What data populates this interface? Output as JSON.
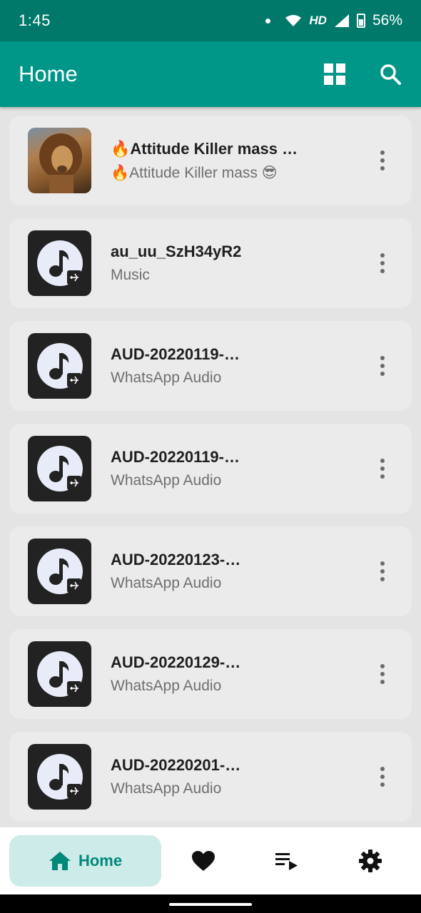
{
  "status_bar": {
    "time": "1:45",
    "network": "HD",
    "battery": "56%"
  },
  "app_bar": {
    "title": "Home",
    "actions": [
      "grid-view-icon",
      "search-icon"
    ]
  },
  "songs": [
    {
      "title": "🔥Attitude Killer mass …",
      "subtitle": "🔥Attitude Killer mass 😎",
      "thumb": "lion-photo"
    },
    {
      "title": "au_uu_SzH34yR2",
      "subtitle": "Music",
      "thumb": "music-note-icon"
    },
    {
      "title": "AUD-20220119-…",
      "subtitle": "WhatsApp Audio",
      "thumb": "music-note-icon"
    },
    {
      "title": "AUD-20220119-…",
      "subtitle": "WhatsApp Audio",
      "thumb": "music-note-icon"
    },
    {
      "title": "AUD-20220123-…",
      "subtitle": "WhatsApp Audio",
      "thumb": "music-note-icon"
    },
    {
      "title": "AUD-20220129-…",
      "subtitle": "WhatsApp Audio",
      "thumb": "music-note-icon"
    },
    {
      "title": "AUD-20220201-…",
      "subtitle": "WhatsApp Audio",
      "thumb": "music-note-icon"
    }
  ],
  "bottom_nav": {
    "home_label": "Home",
    "items": [
      "home-icon",
      "heart-icon",
      "playlist-icon",
      "settings-icon"
    ]
  },
  "colors": {
    "status_bar": "#00796b",
    "app_bar": "#009688",
    "accent": "#00897b",
    "active_pill": "#cdebe8"
  }
}
